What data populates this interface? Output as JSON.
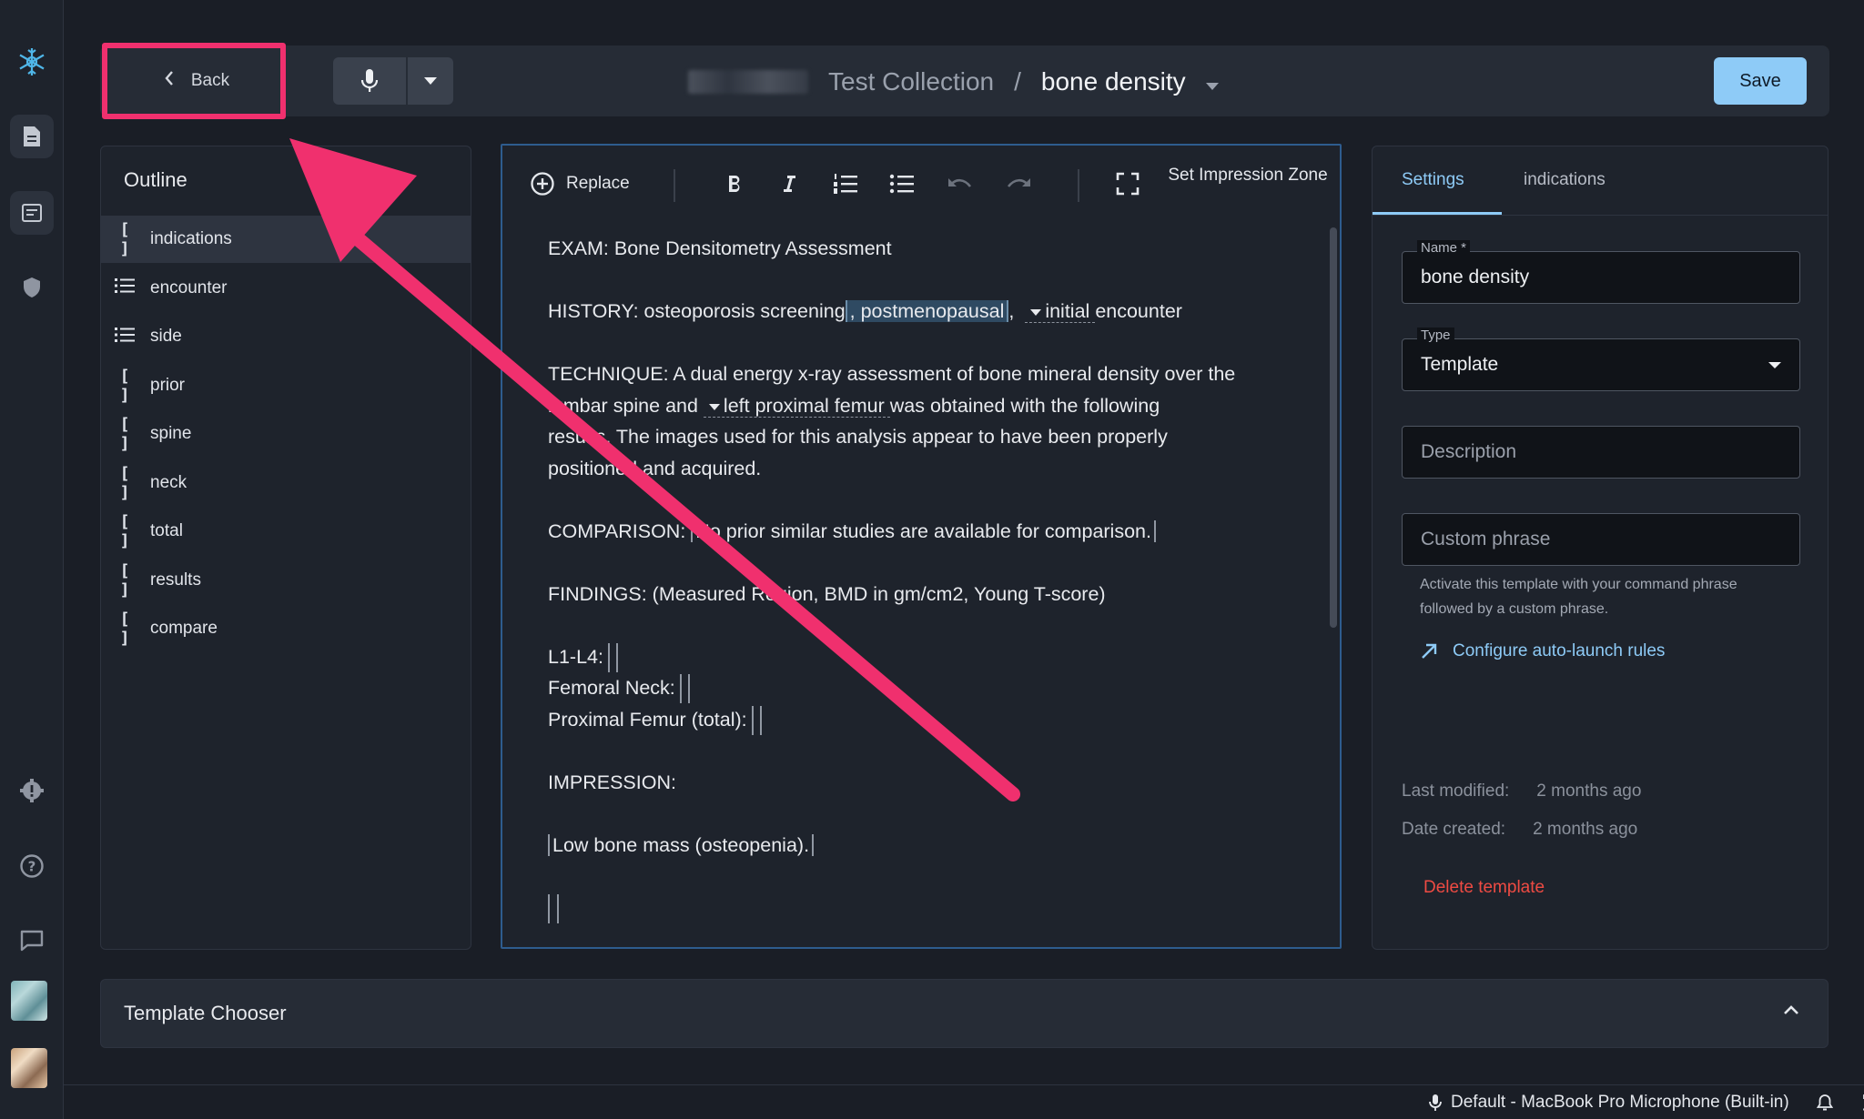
{
  "header": {
    "back_label": "Back",
    "collection": "Test Collection",
    "separator": "/",
    "current": "bone density",
    "save_label": "Save"
  },
  "outline": {
    "title": "Outline",
    "items": [
      {
        "label": "indications",
        "icon": "bracket-icon",
        "glyph": "[ ]"
      },
      {
        "label": "encounter",
        "icon": "list-icon",
        "glyph": ""
      },
      {
        "label": "side",
        "icon": "list-icon",
        "glyph": ""
      },
      {
        "label": "prior",
        "icon": "bracket-icon",
        "glyph": "[ ]"
      },
      {
        "label": "spine",
        "icon": "bracket-icon",
        "glyph": "[ ]"
      },
      {
        "label": "neck",
        "icon": "bracket-icon",
        "glyph": "[ ]"
      },
      {
        "label": "total",
        "icon": "bracket-icon",
        "glyph": "[ ]"
      },
      {
        "label": "results",
        "icon": "bracket-icon",
        "glyph": "[ ]"
      },
      {
        "label": "compare",
        "icon": "bracket-icon",
        "glyph": "[ ]"
      }
    ]
  },
  "editor": {
    "replace_label": "Replace",
    "impression_label": "Set Impression Zone",
    "exam": "EXAM: Bone Densitometry Assessment",
    "history_prefix": "HISTORY: osteoporosis screening",
    "history_field": ", postmenopausal",
    "history_comma": ",",
    "history_dropdown": "initial",
    "history_suffix": "encounter",
    "technique_1": "TECHNIQUE: A dual energy x-ray assessment of bone mineral density over the",
    "technique_2a": "lumbar spine and",
    "technique_2_dropdown": "left proximal femur",
    "technique_2b": "was obtained with the following",
    "technique_3": "results. The images used for this analysis appear to have been properly",
    "technique_4": "positioned and acquired.",
    "comparison_label": "COMPARISON:",
    "comparison_field": "No prior similar studies are available for comparison.",
    "findings": "FINDINGS: (Measured Region, BMD in gm/cm2, Young T-score)",
    "l1l4": "L1-L4:",
    "femoral_neck": "Femoral Neck:",
    "proximal_femur": "Proximal Femur (total):",
    "impression": "IMPRESSION:",
    "impression_field": "Low bone mass (osteopenia)."
  },
  "settings": {
    "tabs": [
      "Settings",
      "indications"
    ],
    "name_label": "Name *",
    "name_value": "bone density",
    "type_label": "Type",
    "type_value": "Template",
    "description_placeholder": "Description",
    "custom_phrase_placeholder": "Custom phrase",
    "helper": "Activate this template with your command phrase followed by a custom phrase.",
    "auto_launch_link": "Configure auto-launch rules",
    "last_modified_label": "Last modified:",
    "last_modified_value": "2 months ago",
    "date_created_label": "Date created:",
    "date_created_value": "2 months ago",
    "delete_label": "Delete template"
  },
  "chooser": {
    "title": "Template Chooser"
  },
  "status": {
    "microphone": "Default - MacBook Pro Microphone (Built-in)"
  },
  "colors": {
    "accent": "#8ecbf7",
    "annotation": "#f0306e",
    "danger": "#ef4b43",
    "background": "#1a1e26"
  }
}
